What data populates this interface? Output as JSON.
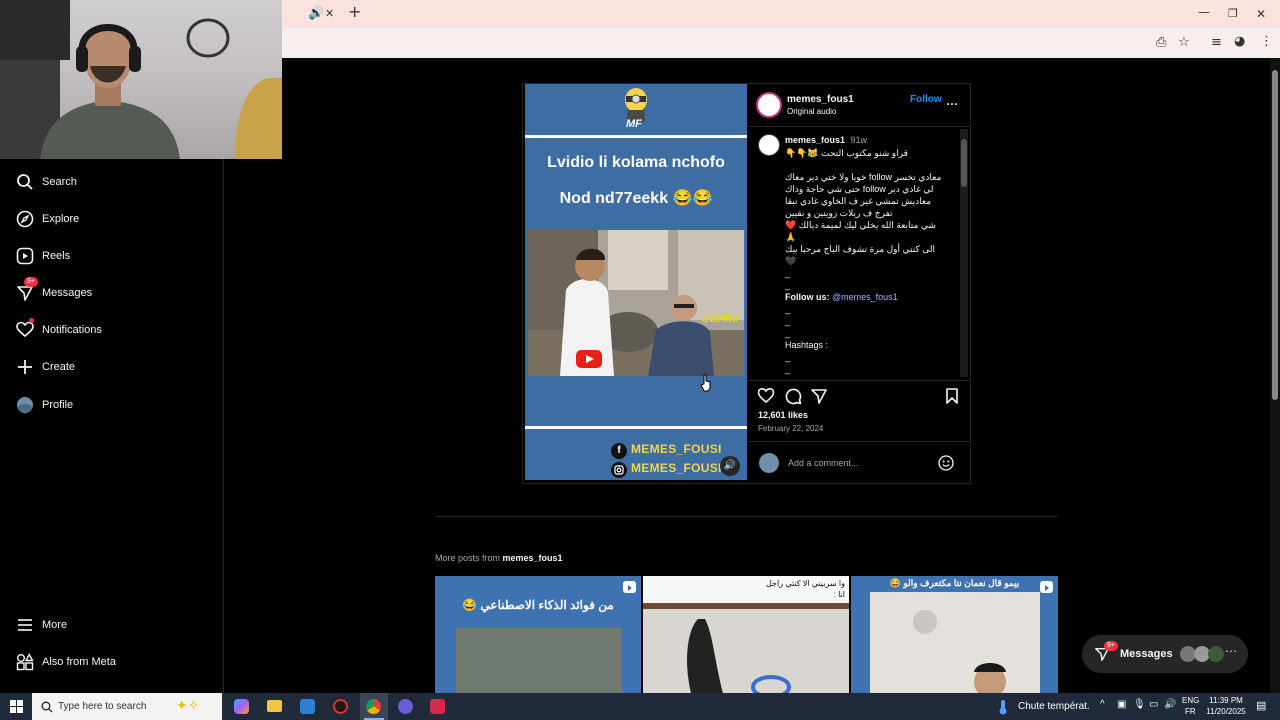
{
  "browser": {
    "tab_close": "✕",
    "new_tab": "+"
  },
  "sidebar": {
    "items": [
      {
        "label": "Search",
        "icon": "search-icon"
      },
      {
        "label": "Explore",
        "icon": "compass-icon"
      },
      {
        "label": "Reels",
        "icon": "reels-icon"
      },
      {
        "label": "Messages",
        "icon": "messenger-icon",
        "badge": "9+"
      },
      {
        "label": "Notifications",
        "icon": "heart-icon"
      },
      {
        "label": "Create",
        "icon": "plus-icon"
      },
      {
        "label": "Profile",
        "icon": "avatar-icon"
      }
    ],
    "bottom": [
      {
        "label": "More",
        "icon": "menu-icon"
      },
      {
        "label": "Also from Meta",
        "icon": "meta-apps-icon"
      }
    ]
  },
  "media": {
    "logo_text": "MF",
    "title_line1": "Lvidio li kolama nchofo",
    "title_line2": "Nod nd77eekk 😂😂",
    "facebook_handle": "MEMES_FOUSI",
    "instagram_handle": "MEMES_FOUSI"
  },
  "post": {
    "username": "memes_fous1",
    "audio": "Original audio",
    "follow_label": "Follow",
    "more": "…",
    "caption_user": "memes_fous1",
    "caption_age": "91w",
    "caption_lines": [
      "قراو شنو مكتوب التحت 😹👇👇",
      "",
      "معادي تخسر follow خويا ولا ختي دير معاك",
      "لي غادي دير follow حتى شي حاجة وذاك",
      "معاديش تمشي غير ف الخاوي غادي تبقا",
      "تفرج ف ريلات زوينين و نقيين",
      "شي متابعة الله يخلي ليك لميمة ديالك ❤️",
      "🙏",
      "الى كنتي أول مرة تشوف الباج مرحبا بيك",
      "🖤",
      "_",
      "_"
    ],
    "follow_us_label": "Follow us:",
    "follow_us_handle": "@memes_fous1",
    "dashes": [
      "_",
      "_",
      "_"
    ],
    "hashtags_label": "Hashtags :",
    "dashes2": [
      "_",
      "_"
    ],
    "likes": "12,601 likes",
    "date": "February 22, 2024",
    "comment_placeholder": "Add a comment..."
  },
  "more_posts": {
    "prefix": "More posts from ",
    "username": "memes_fous1",
    "thumbs": [
      {
        "text": "من فوائد الذكاء الاصطناعي 😂"
      },
      {
        "text": "وا سربيني الا كنتي راجل\nانا :"
      },
      {
        "text": "بيمو قال نعمان نتا مكتعرف والو 😂"
      }
    ]
  },
  "messages_pill": {
    "label": "Messages",
    "badge": "9+"
  },
  "taskbar": {
    "search_placeholder": "Type here to search",
    "weather": "Chute températ.",
    "lang_top": "ENG",
    "lang_bottom": "FR",
    "time": "11:39 PM",
    "date": "11/20/2025"
  },
  "colors": {
    "accent_blue": "#0095f6",
    "link_purple": "#a8b3ff",
    "badge_red": "#ff3040",
    "media_blue": "#3d6da3",
    "title_yellow": "#f2d54a"
  }
}
